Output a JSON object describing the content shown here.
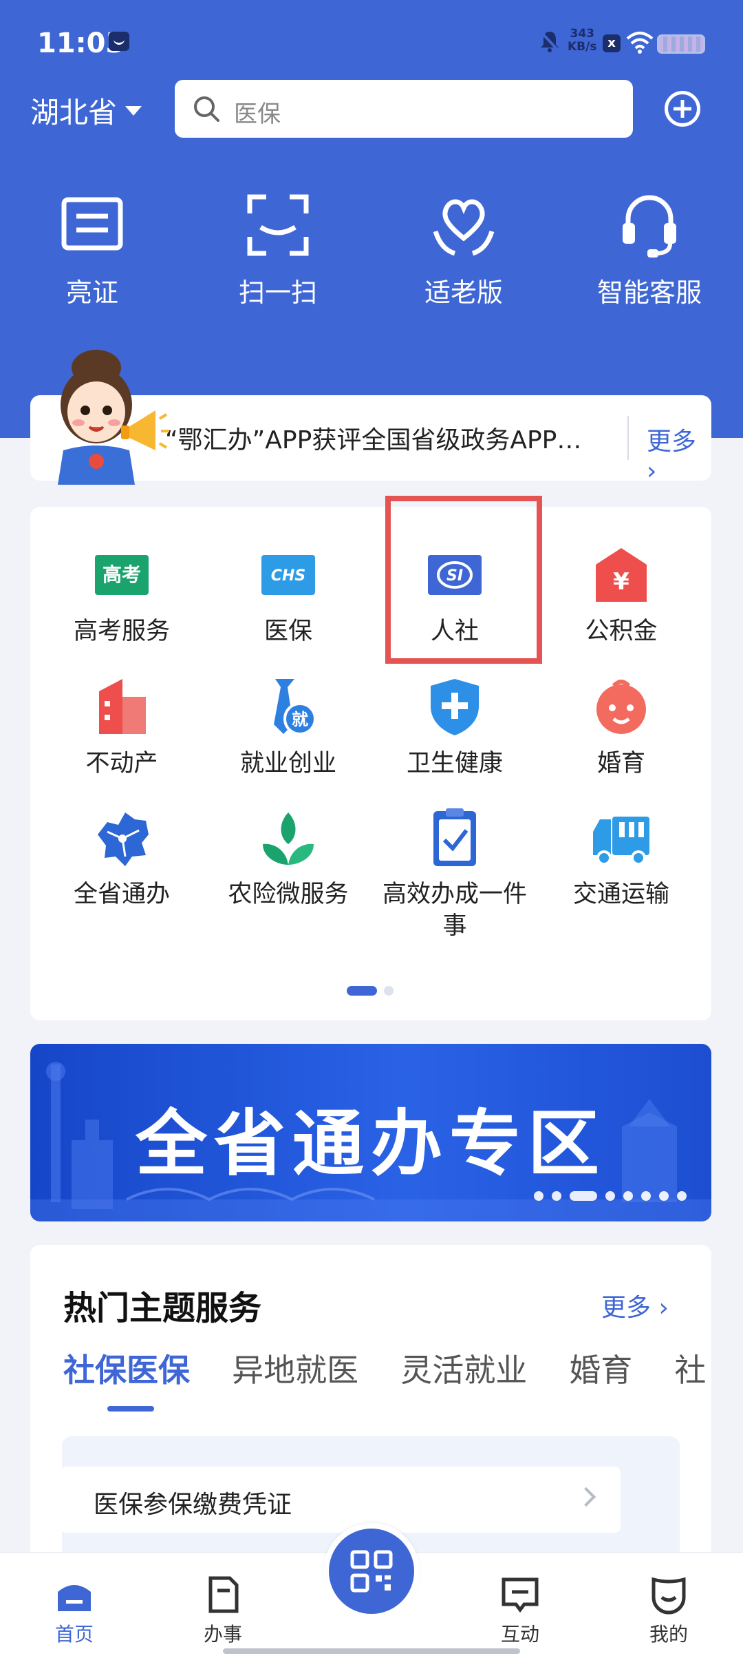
{
  "status_bar": {
    "time": "11:03",
    "net_speed_value": "343",
    "net_speed_unit": "KB/s",
    "x_badge": "x"
  },
  "header": {
    "province": "湖北省",
    "search_placeholder": "医保"
  },
  "quick_actions": [
    {
      "label": "亮证",
      "icon": "card-icon"
    },
    {
      "label": "扫一扫",
      "icon": "scan-icon"
    },
    {
      "label": "适老版",
      "icon": "elder-heart-icon"
    },
    {
      "label": "智能客服",
      "icon": "headset-icon"
    }
  ],
  "notice": {
    "text": "“鄂汇办”APP获评全国省级政务APP…",
    "more": "更多"
  },
  "services": [
    {
      "label": "高考服务",
      "icon": "gaokao-icon",
      "icon_text": "高考"
    },
    {
      "label": "医保",
      "icon": "chs-icon",
      "icon_text": "CHS"
    },
    {
      "label": "人社",
      "icon": "si-icon",
      "icon_text": "SI"
    },
    {
      "label": "公积金",
      "icon": "housing-fund-icon",
      "icon_text": "¥"
    },
    {
      "label": "不动产",
      "icon": "real-estate-icon"
    },
    {
      "label": "就业创业",
      "icon": "employment-icon",
      "icon_text": "就"
    },
    {
      "label": "卫生健康",
      "icon": "health-shield-icon"
    },
    {
      "label": "婚育",
      "icon": "baby-icon"
    },
    {
      "label": "全省通办",
      "icon": "province-map-icon"
    },
    {
      "label": "农险微服务",
      "icon": "sprout-icon"
    },
    {
      "label": "高效办成一件事",
      "icon": "clipboard-check-icon"
    },
    {
      "label": "交通运输",
      "icon": "truck-icon"
    }
  ],
  "banner": {
    "title": "全省通办专区"
  },
  "hot": {
    "title": "热门主题服务",
    "more": "更多",
    "tabs": [
      "社保医保",
      "异地就医",
      "灵活就业",
      "婚育",
      "社"
    ],
    "active_tab": 0,
    "first_item": "医保参保缴费凭证"
  },
  "tabbar": [
    {
      "label": "首页",
      "active": true
    },
    {
      "label": "办事",
      "active": false
    },
    {
      "label": "互动",
      "active": false
    },
    {
      "label": "我的",
      "active": false
    }
  ],
  "colors": {
    "brand": "#3e66d5",
    "highlight": "#e35452"
  }
}
